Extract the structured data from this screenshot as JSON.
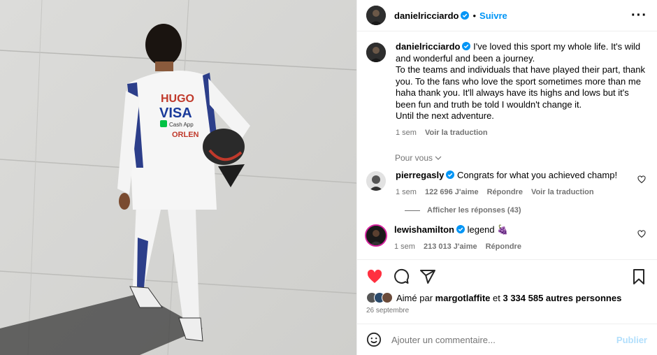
{
  "post": {
    "author": "danielricciardo",
    "follow_label": "Suivre",
    "separator": "•"
  },
  "caption": {
    "author": "danielricciardo",
    "lines": [
      "I've loved this sport my whole life. It's wild and wonderful and been a journey.",
      "To the teams and individuals that have played their part, thank you. To the fans who love the sport sometimes more than me haha thank you. It'll always have its highs and lows but it's been fun and truth be told I wouldn't change it.",
      "Until the next adventure."
    ],
    "time": "1 sem",
    "translate": "Voir la traduction"
  },
  "for_you": "Pour vous",
  "comments": [
    {
      "author": "pierregasly",
      "text": "Congrats for what you achieved champ!",
      "time": "1 sem",
      "likes": "122 696 J'aime",
      "reply": "Répondre",
      "translate": "Voir la traduction"
    },
    {
      "author": "lewishamilton",
      "text": "legend 🍇",
      "time": "1 sem",
      "likes": "213 013 J'aime",
      "reply": "Répondre"
    }
  ],
  "view_replies": "Afficher les réponses (43)",
  "liked_by": {
    "prefix": "Aimé par",
    "user": "margotlaffite",
    "middle": "et",
    "count": "3 334 585 autres personnes"
  },
  "date": "26 septembre",
  "add_comment": {
    "placeholder": "Ajouter un commentaire...",
    "publish": "Publier"
  },
  "photo": {
    "suit_logos": [
      "HUGO",
      "VISA",
      "Cash App",
      "ORLEN"
    ]
  },
  "colors": {
    "accent": "#0095f6",
    "like": "#ff3040",
    "muted": "#737373"
  }
}
